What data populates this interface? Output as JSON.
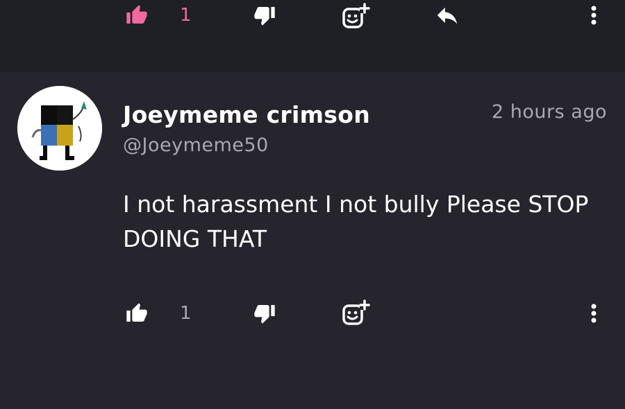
{
  "previous_comment": {
    "like_count": "1",
    "liked": true,
    "icons": [
      "thumbs-up-icon",
      "thumbs-down-icon",
      "emoji-react-icon",
      "reply-icon",
      "more-vertical-icon"
    ],
    "colors": {
      "liked": "#f06aa0",
      "icon": "#ffffff"
    }
  },
  "comment": {
    "author_name": "Joeymeme crimson",
    "handle": "@Joeymeme50",
    "timestamp": "2 hours ago",
    "text": "I not harassment I not bully Please STOP DOING THAT",
    "like_count": "1",
    "liked": false,
    "icons": [
      "thumbs-up-icon",
      "thumbs-down-icon",
      "emoji-react-icon",
      "more-vertical-icon"
    ],
    "colors": {
      "count": "#a9a8b3",
      "icon": "#ffffff"
    }
  },
  "theme": {
    "background": "#26252e",
    "previous_background": "#1f1f26"
  }
}
